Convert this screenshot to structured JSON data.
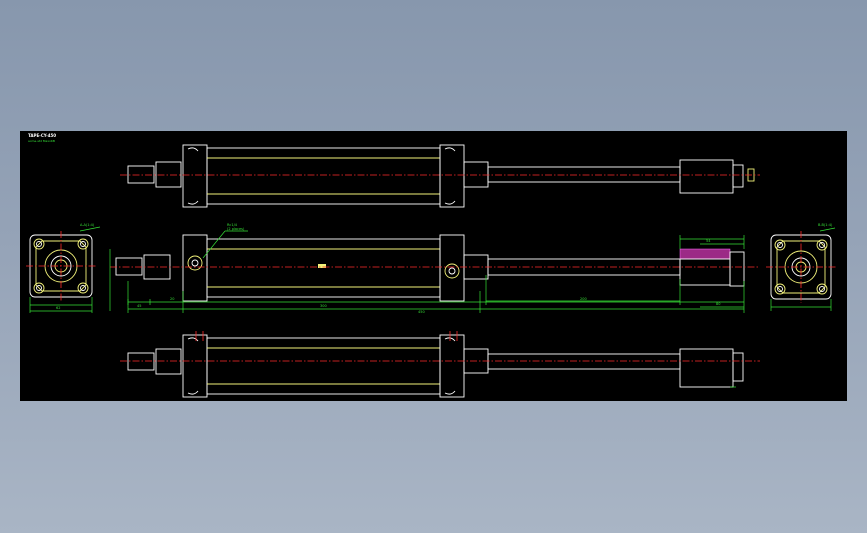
{
  "drawing": {
    "title": "TAPE-CY-450",
    "subtitle": "acme-std MaxxKB",
    "background": "#000000",
    "page_background": "#8f9db2",
    "colors": {
      "outline": "#f2f27a",
      "edges": "#ffffff",
      "centerline": "#ff2a2a",
      "dimension": "#36e036",
      "hatch": "#9c2a86"
    },
    "views": [
      "top-view",
      "front-view",
      "bottom-view",
      "left-end-view",
      "right-end-view"
    ],
    "labels": {
      "left_end_tag": "A-A(1:4)",
      "right_end_tag": "B-B(1:4)",
      "port_note": "Rc1/4",
      "port_note_sub": "(2 places)",
      "dim_total": "450",
      "dim_body": "300",
      "dim_rod": "200",
      "dim_left": "45",
      "dim_left2": "20",
      "dim_small": "54",
      "dim_end": "80",
      "dim_end_width": "62"
    }
  }
}
